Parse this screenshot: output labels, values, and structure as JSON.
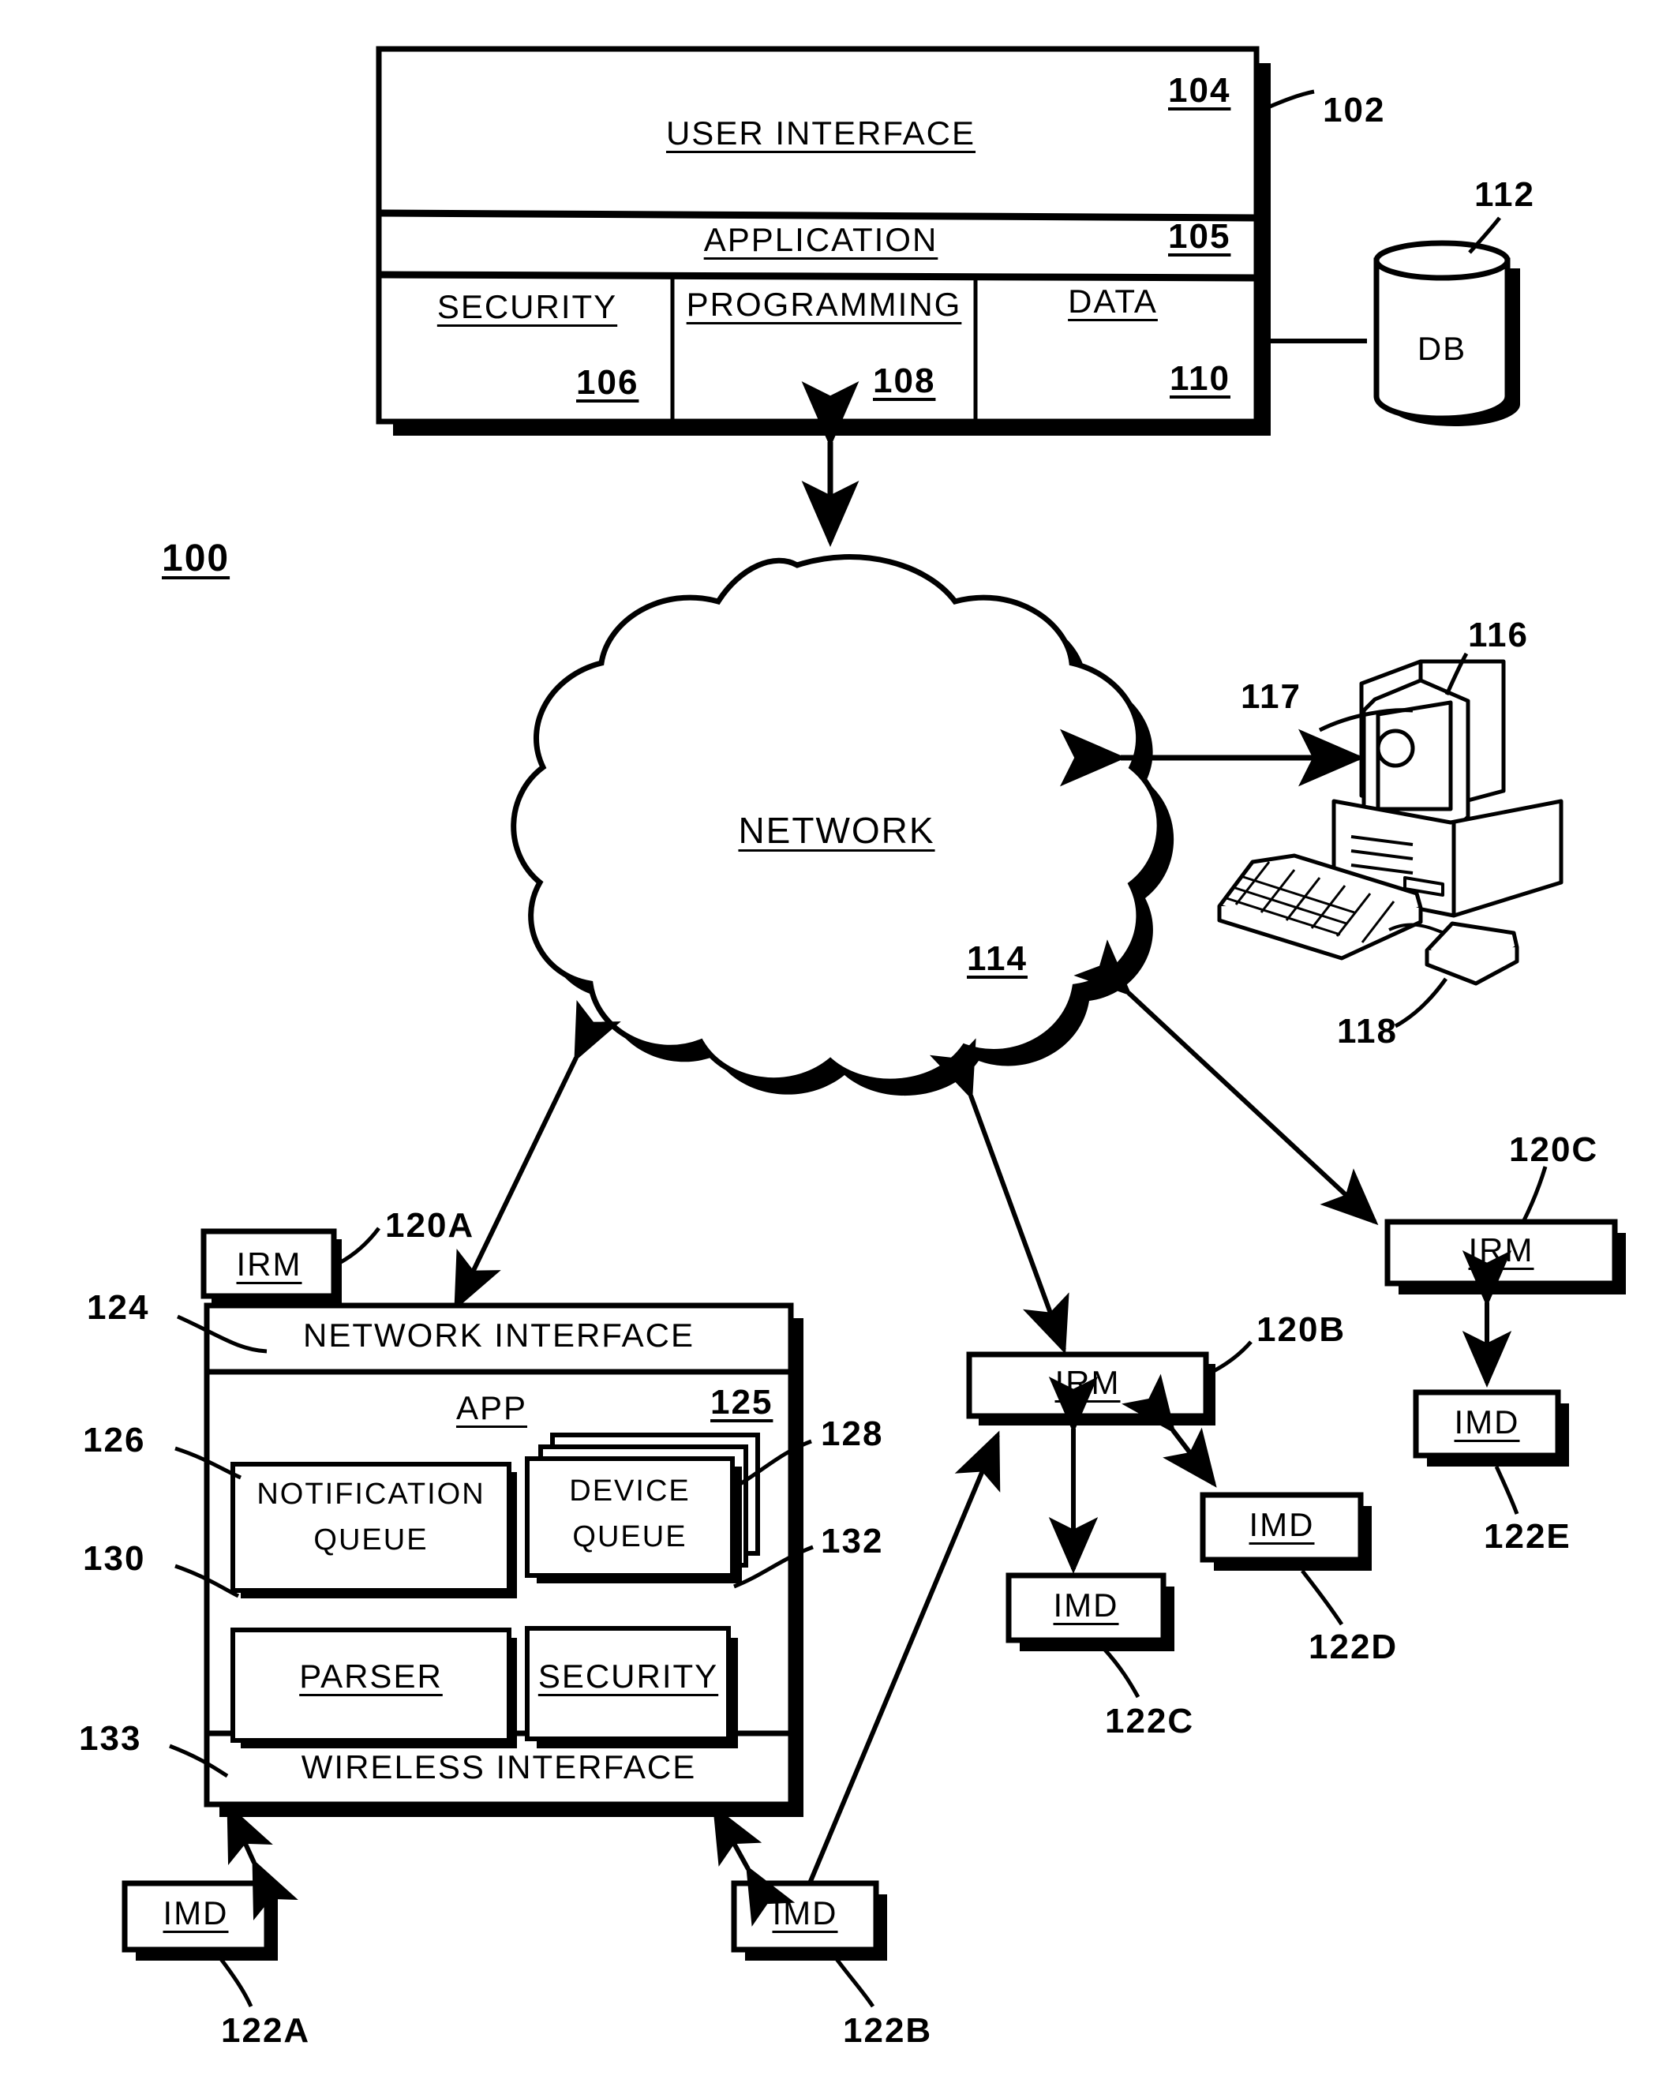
{
  "figure": {
    "system_ref": "100",
    "top_unit": {
      "ref": "102",
      "rows": [
        {
          "label": "USER INTERFACE",
          "ref": "104"
        },
        {
          "label": "APPLICATION",
          "ref": "105"
        }
      ],
      "cells": [
        {
          "label": "SECURITY",
          "ref": "106"
        },
        {
          "label": "PROGRAMMING",
          "ref": "108"
        },
        {
          "label": "DATA",
          "ref": "110"
        }
      ]
    },
    "database": {
      "label": "DB",
      "ref": "112"
    },
    "network": {
      "label": "NETWORK",
      "ref": "114"
    },
    "workstation": {
      "computer_ref": "116",
      "display_ref": "117",
      "peripheral_ref": "118"
    },
    "irm_main": {
      "ref": "120A",
      "badge": "IRM",
      "network_interface": {
        "label": "NETWORK INTERFACE",
        "ref": "124"
      },
      "app": {
        "label": "APP",
        "ref": "125"
      },
      "modules": [
        {
          "label_line1": "NOTIFICATION",
          "label_line2": "QUEUE",
          "ref": "126"
        },
        {
          "label_line1": "DEVICE",
          "label_line2": "QUEUE",
          "ref": "128"
        },
        {
          "label_line1": "PARSER",
          "label_line2": "",
          "ref": "130"
        },
        {
          "label_line1": "SECURITY",
          "label_line2": "",
          "ref": "132"
        }
      ],
      "wireless_interface": {
        "label": "WIRELESS INTERFACE",
        "ref": "133"
      }
    },
    "irm_b": {
      "label": "IRM",
      "ref": "120B"
    },
    "irm_c": {
      "label": "IRM",
      "ref": "120C"
    },
    "imds": [
      {
        "label": "IMD",
        "ref": "122A"
      },
      {
        "label": "IMD",
        "ref": "122B"
      },
      {
        "label": "IMD",
        "ref": "122C"
      },
      {
        "label": "IMD",
        "ref": "122D"
      },
      {
        "label": "IMD",
        "ref": "122E"
      }
    ],
    "colors": {
      "ink": "#000000",
      "paper": "#ffffff"
    }
  }
}
